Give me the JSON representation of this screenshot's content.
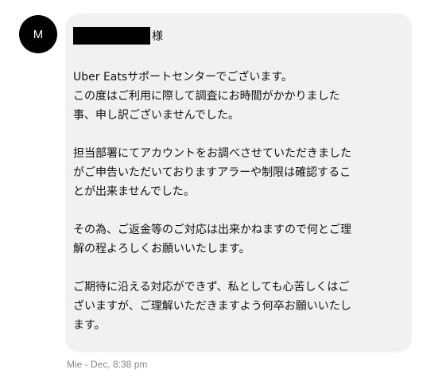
{
  "sender": {
    "avatar_initial": "M"
  },
  "message": {
    "salutation_suffix": "様",
    "paragraphs": [
      [
        "Uber Eatsサポートセンターでございます。",
        "この度はご利用に際して調査にお時間がかかりました",
        "事、申し訳ございませんでした。"
      ],
      [
        "担当部署にてアカウントをお調べさせていただきました",
        "がご申告いただいておりますアラーや制限は確認するこ",
        "とが出来ませんでした。"
      ],
      [
        "その為、ご返金等のご対応は出来かねますので何とご理",
        "解の程よろしくお願いいたします。"
      ],
      [
        "ご期待に沿える対応ができず、私としても心苦しくはご",
        "ざいますが、ご理解いただきますよう何卒お願いいたし",
        "ます。"
      ]
    ]
  },
  "meta": {
    "timestamp": "Mie - Dec, 8:38 pm"
  },
  "colors": {
    "bubble": "#f1f1f1",
    "avatar": "#000000",
    "meta_text": "#888888"
  }
}
